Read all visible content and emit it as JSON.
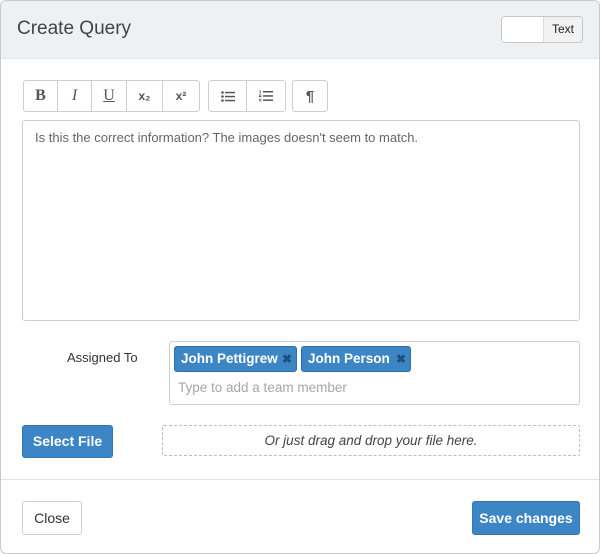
{
  "modal": {
    "title": "Create Query",
    "mode_toggle_label": "Text"
  },
  "toolbar": {
    "bold": "B",
    "italic": "I",
    "underline": "U",
    "subscript": "x₂",
    "superscript": "x²",
    "bulleted_list_icon": "bulleted-list-icon",
    "numbered_list_icon": "numbered-list-icon",
    "paragraph": "¶"
  },
  "editor": {
    "content": "Is this the correct information? The images doesn't seem to match."
  },
  "assignment": {
    "label": "Assigned To",
    "tags": [
      "John Pettigrew",
      "John Person"
    ],
    "remove_glyph": "✖",
    "placeholder": "Type to add a team member"
  },
  "file": {
    "select_label": "Select File",
    "dropzone_text": "Or just drag and drop your file here."
  },
  "footer": {
    "close_label": "Close",
    "save_label": "Save changes"
  },
  "colors": {
    "accent": "#3d86c6",
    "header_bg": "#eef1f3"
  }
}
